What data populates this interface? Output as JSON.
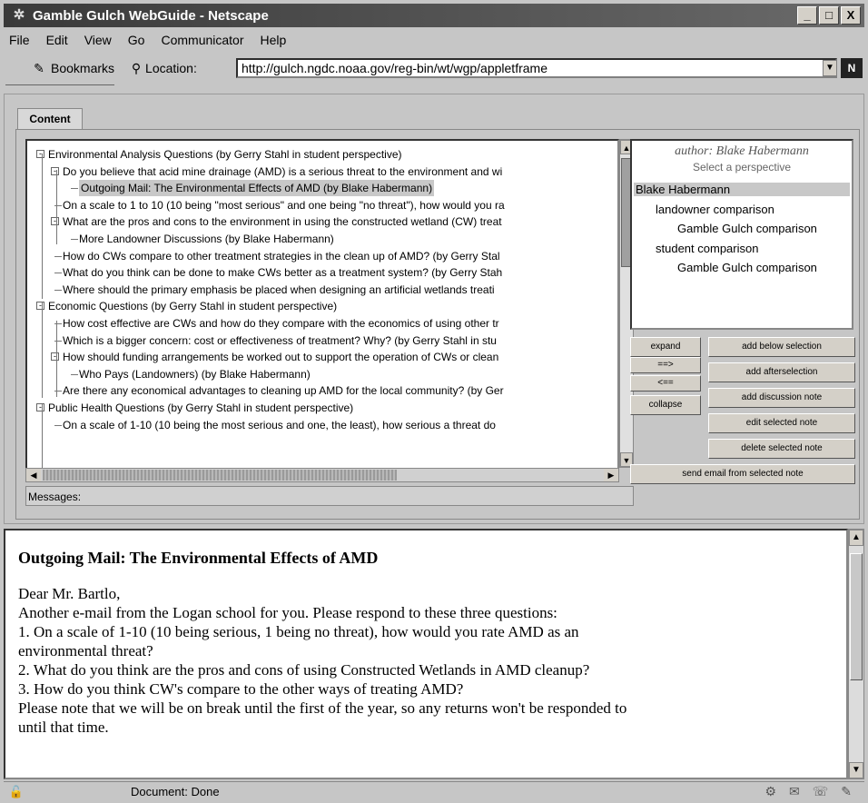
{
  "window": {
    "title": "Gamble Gulch WebGuide - Netscape",
    "buttons": {
      "minimize": "_",
      "maximize": "□",
      "close": "X"
    }
  },
  "menu": [
    "File",
    "Edit",
    "View",
    "Go",
    "Communicator",
    "Help"
  ],
  "toolbar": {
    "bookmarks_label": "Bookmarks",
    "location_label": "Location:",
    "url": "http://gulch.ngdc.noaa.gov/reg-bin/wt/wgp/appletframe"
  },
  "applet": {
    "tab_label": "Content",
    "tree": [
      {
        "text": "Environmental Analysis Questions  (by Gerry Stahl in student perspective)",
        "level": 0,
        "expander": "-"
      },
      {
        "text": "Do you believe that acid mine drainage (AMD) is a serious threat to the environment and wi",
        "level": 1,
        "expander": "-"
      },
      {
        "text": "Outgoing Mail: The Environmental Effects of AMD  (by Blake Habermann)",
        "level": 2,
        "selected": true
      },
      {
        "text": "On a scale to 1 to 10 (10 being \"most serious\" and one being \"no threat\"), how would you ra",
        "level": 1
      },
      {
        "text": "What are the pros and cons to the environment in using the constructed wetland (CW) treat",
        "level": 1,
        "expander": "-"
      },
      {
        "text": "More Landowner Discussions  (by Blake Habermann)",
        "level": 2
      },
      {
        "text": "How do CWs compare to other treatment strategies in the clean up of AMD?  (by Gerry Stal",
        "level": 1
      },
      {
        "text": "What do you think can be done to make CWs better as a treatment system?  (by Gerry Stah",
        "level": 1
      },
      {
        "text": "Where should the primary emphasis be placed when designing an artificial wetlands treati",
        "level": 1
      },
      {
        "text": "Economic Questions  (by Gerry Stahl in student perspective)",
        "level": 0,
        "expander": "-"
      },
      {
        "text": "How cost effective are CWs and how do they compare with the economics of using other tr",
        "level": 1
      },
      {
        "text": "Which is a bigger concern:  cost or effectiveness of treatment?  Why?  (by Gerry Stahl in stu",
        "level": 1
      },
      {
        "text": "How should funding arrangements be worked out to support the operation of  CWs or clean",
        "level": 1,
        "expander": "-"
      },
      {
        "text": "Who Pays (Landowners)  (by Blake Habermann)",
        "level": 2
      },
      {
        "text": "Are there any economical advantages to cleaning up AMD for the local community?  (by Ger",
        "level": 1
      },
      {
        "text": "Public Health Questions  (by Gerry Stahl in student perspective)",
        "level": 0,
        "expander": "-"
      },
      {
        "text": "On a scale of 1-10 (10 being the most serious and one, the least), how serious a threat do",
        "level": 1
      }
    ],
    "messages_label": "Messages:",
    "author": "author: Blake Habermann",
    "select_perspective": "Select a perspective",
    "perspectives": [
      {
        "text": "Blake Habermann",
        "level": 0,
        "selected": true
      },
      {
        "text": "landowner comparison",
        "level": 1
      },
      {
        "text": "Gamble Gulch comparison",
        "level": 2
      },
      {
        "text": "student comparison",
        "level": 1
      },
      {
        "text": "Gamble Gulch comparison",
        "level": 2
      }
    ],
    "nav_buttons": {
      "expand": "expand",
      "right": "==>",
      "left": "<==",
      "collapse": "collapse"
    },
    "action_buttons": {
      "add_below": "add below selection",
      "add_after": "add afterselection",
      "add_discussion": "add discussion note",
      "edit_note": "edit selected note",
      "delete_note": "delete selected note",
      "send_email": "send email from selected note"
    }
  },
  "document": {
    "title": "Outgoing Mail: The Environmental Effects of AMD",
    "lines": [
      "Dear Mr. Bartlo,",
      "Another e-mail from the Logan school for you. Please respond to these three questions:",
      "1. On a scale of 1-10 (10 being serious, 1 being no threat), how would you rate AMD as an",
      "environmental threat?",
      "2. What do you think are the pros and cons of using Constructed Wetlands in AMD cleanup?",
      "3. How do you think CW's compare to the other ways of treating AMD?",
      "Please note that we will be on break until the first of the year, so any returns won't be responded to",
      "until that time."
    ]
  },
  "status": {
    "text": "Document: Done"
  }
}
